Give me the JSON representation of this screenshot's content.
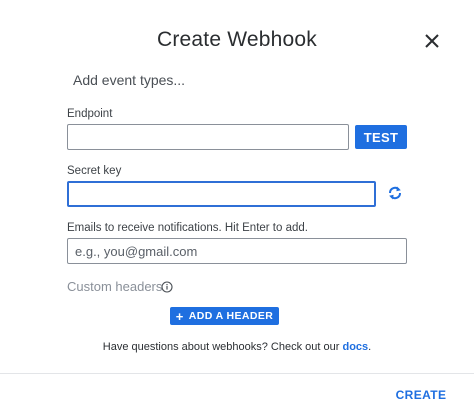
{
  "dialog": {
    "title": "Create Webhook",
    "close_icon": "close-icon"
  },
  "events": {
    "add_label": "Add event types..."
  },
  "endpoint": {
    "label": "Endpoint",
    "value": "",
    "test_button": "TEST"
  },
  "secret": {
    "label": "Secret key",
    "value": "",
    "refresh_icon": "refresh-icon"
  },
  "emails": {
    "label": "Emails to receive notifications. Hit Enter to add.",
    "placeholder": "e.g., you@gmail.com"
  },
  "headers": {
    "label": "Custom headers",
    "info_icon": "info-icon",
    "add_button": "ADD A HEADER"
  },
  "help": {
    "text": "Have questions about webhooks? Check out our ",
    "link": "docs",
    "suffix": "."
  },
  "footer": {
    "create_button": "CREATE"
  },
  "colors": {
    "accent": "#1f6fe0",
    "border": "#8a9099",
    "focus": "#2f6fd6"
  }
}
